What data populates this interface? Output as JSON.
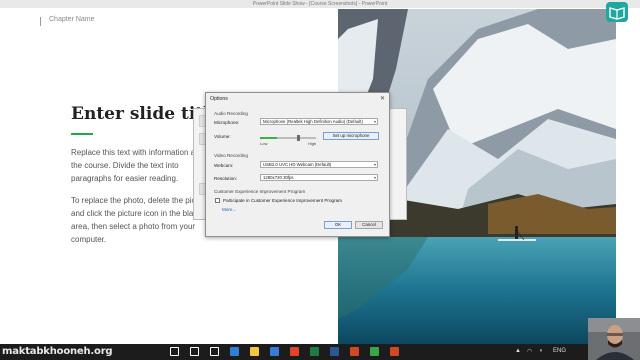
{
  "window": {
    "title": "PowerPoint Slide Show - [Course Screenshots] - PowerPoint"
  },
  "slide": {
    "chapter_name": "Chapter Name",
    "title": "Enter slide title",
    "paragraph1": "Replace this text with information about the course. Divide the text into paragraphs for easier reading.",
    "paragraph2": "To replace the photo, delete the picture and click the picture icon in the blank area, then select a photo from your computer."
  },
  "dialog": {
    "title": "Options",
    "close_glyph": "✕",
    "audio_section": "Audio Recording",
    "microphone_label": "Microphone:",
    "microphone_value": "Microphone (Realtek High Definition Audio) (Default)",
    "volume_label": "Volume:",
    "volume_level": 0.3,
    "volume_low": "Low",
    "volume_high": "High",
    "setup_mic_button": "Set up microphone",
    "video_section": "Video Recording",
    "webcam_label": "Webcam:",
    "webcam_value": "USB2.0 UVC HD Webcam (Default)",
    "resolution_label": "Resolution:",
    "resolution_value": "1280x720 30fps",
    "ceip_section": "Customer Experience Improvement Program",
    "ceip_checkbox_label": "Participate in Customer Experience Improvement Program",
    "ceip_checked": false,
    "more_link": "More...",
    "ok_button": "OK",
    "cancel_button": "Cancel"
  },
  "taskbar": {
    "watermark": "maktabkhooneh.org",
    "icons": [
      "windows-icon",
      "search-icon",
      "task-view-icon",
      "edge-icon",
      "file-explorer-icon",
      "store-icon",
      "chrome-icon",
      "excel-icon",
      "word-icon",
      "powerpoint-icon",
      "camtasia-icon",
      "app-icon"
    ],
    "icon_colors": [
      "#ffffff",
      "#ffffff",
      "#ffffff",
      "#2f7fd6",
      "#f5c542",
      "#3a7bd5",
      "#e0442f",
      "#1f7a45",
      "#2b5797",
      "#d24726",
      "#3aa64a",
      "#d24726"
    ],
    "language": "ENG"
  },
  "colors": {
    "accent_green": "#22a64c",
    "link_blue": "#1a5fb4"
  }
}
